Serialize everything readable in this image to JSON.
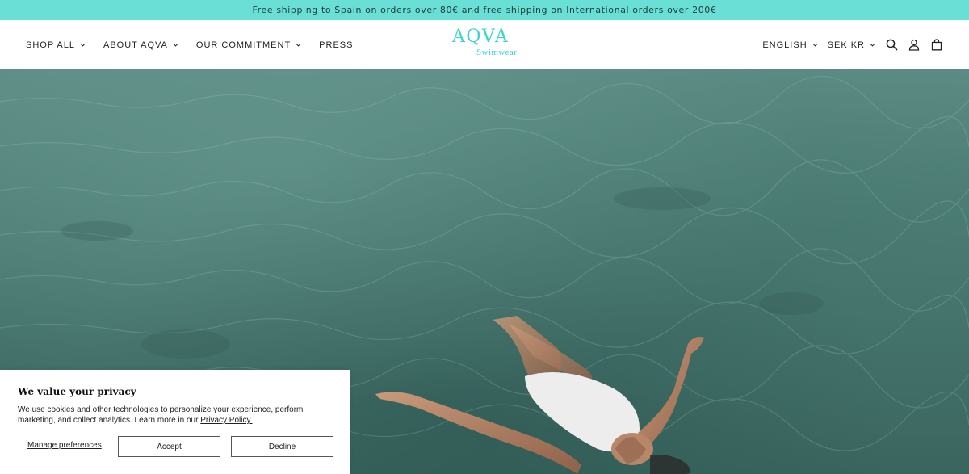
{
  "announcement": {
    "text": "Free shipping to Spain on orders over 80€ and free shipping on International orders over 200€"
  },
  "header": {
    "nav": [
      {
        "label": "SHOP ALL",
        "has_dropdown": true
      },
      {
        "label": "ABOUT AQVA",
        "has_dropdown": true
      },
      {
        "label": "OUR COMMITMENT",
        "has_dropdown": true
      },
      {
        "label": "PRESS",
        "has_dropdown": false
      }
    ],
    "logo": {
      "main": "AQVA",
      "sub": "Swimwear"
    },
    "language": "ENGLISH",
    "currency": "SEK KR",
    "icons": [
      "search-icon",
      "account-icon",
      "cart-icon"
    ]
  },
  "cookie_banner": {
    "title": "We value your privacy",
    "text": "We use cookies and other technologies to personalize your experience, perform marketing, and collect analytics. Learn more in our ",
    "link": "Privacy Policy.",
    "manage": "Manage preferences",
    "accept": "Accept",
    "decline": "Decline"
  },
  "colors": {
    "announcement_bg": "#6adfd6",
    "brand": "#3fd3cc",
    "water": "#4f7f77"
  }
}
